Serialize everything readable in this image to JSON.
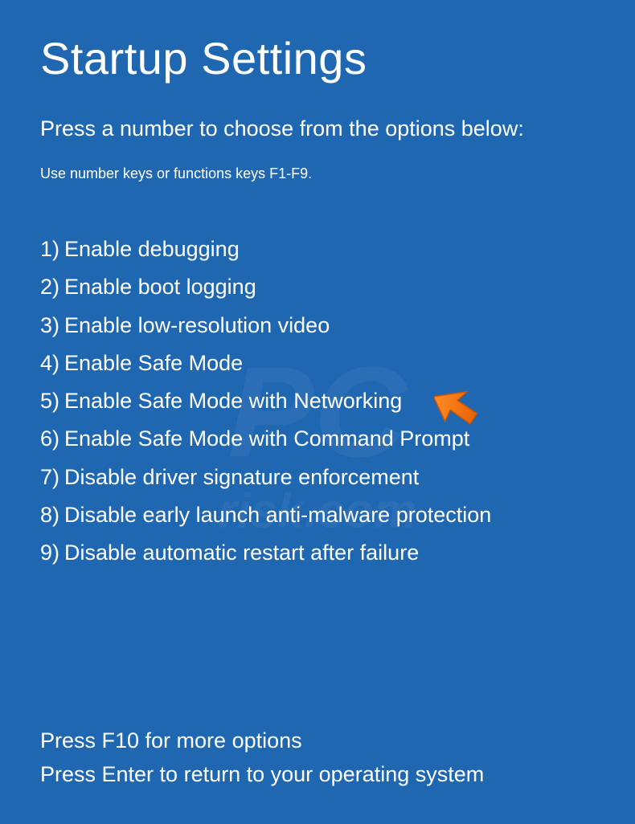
{
  "title": "Startup Settings",
  "instruction": "Press a number to choose from the options below:",
  "subinstruction": "Use number keys or functions keys F1-F9.",
  "options": [
    {
      "number": "1)",
      "label": "Enable debugging"
    },
    {
      "number": "2)",
      "label": "Enable boot logging"
    },
    {
      "number": "3)",
      "label": "Enable low-resolution video"
    },
    {
      "number": "4)",
      "label": "Enable Safe Mode"
    },
    {
      "number": "5)",
      "label": "Enable Safe Mode with Networking"
    },
    {
      "number": "6)",
      "label": "Enable Safe Mode with Command Prompt"
    },
    {
      "number": "7)",
      "label": "Disable driver signature enforcement"
    },
    {
      "number": "8)",
      "label": "Disable early launch anti-malware protection"
    },
    {
      "number": "9)",
      "label": "Disable automatic restart after failure"
    }
  ],
  "footer": {
    "more_options": "Press F10 for more options",
    "return": "Press Enter to return to your operating system"
  },
  "watermark": {
    "main": "PC",
    "sub": "risk.com"
  }
}
